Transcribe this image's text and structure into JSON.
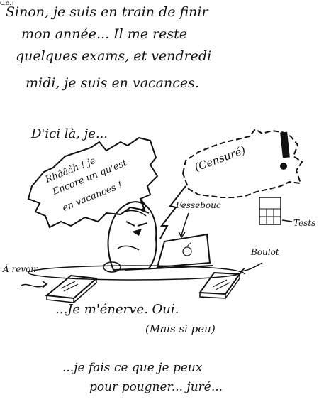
{
  "intro": {
    "line1": "Sinon, je suis en train de finir",
    "line2": "mon année... Il me reste",
    "line3": "quelques exams, et vendredi",
    "line4": "midi, je suis en vacances."
  },
  "scene": {
    "dici": "D'ici là, je...",
    "rage_bubble": {
      "line1": "Rhâââh ! je",
      "line2": "Encore un qu'est",
      "line3": "en vacances !"
    },
    "censure_bubble": "(Censuré)",
    "labels": {
      "revoir": "À revoir",
      "boulot": "Boulot",
      "fessebouc": "Fessebouc",
      "tests": "Tests",
      "cdt": "C.d.T"
    }
  },
  "outro": {
    "enerve": "...Je m'énerve. Oui.",
    "mais_si_peu": "(Mais si peu)",
    "fais1": "...je fais ce que je peux",
    "fais2": "pour pougner... juré..."
  }
}
